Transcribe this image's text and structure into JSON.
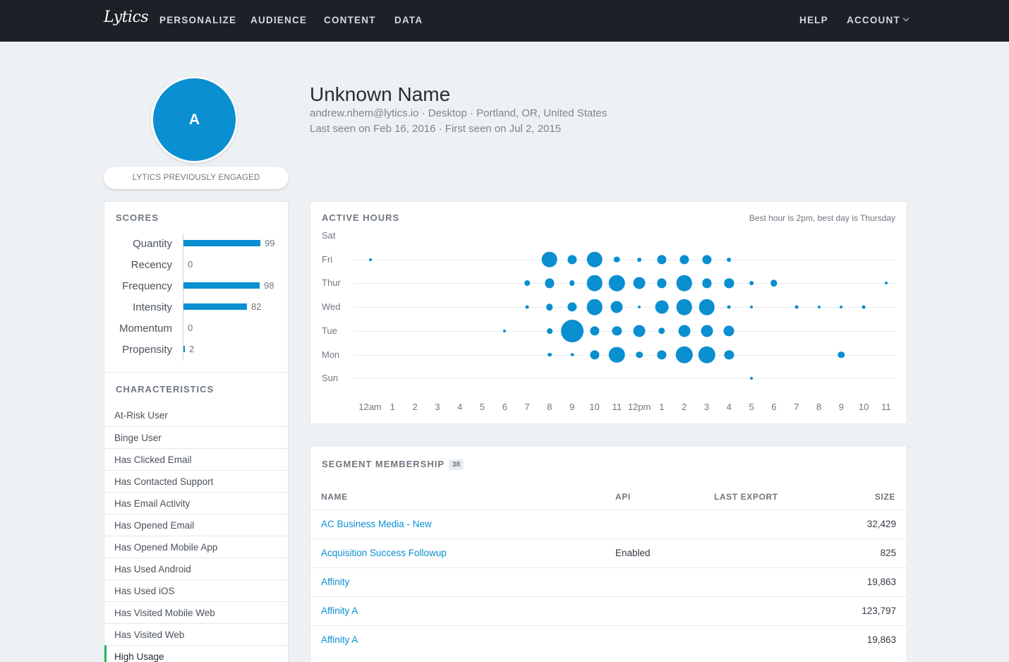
{
  "nav": {
    "logo": "Lytics",
    "items": [
      "PERSONALIZE",
      "AUDIENCE",
      "CONTENT",
      "DATA"
    ],
    "help": "HELP",
    "account": "ACCOUNT"
  },
  "profile": {
    "avatar_initial": "A",
    "engagement": "LYTICS PREVIOUSLY ENGAGED",
    "name": "Unknown Name",
    "details": "andrew.nhem@lytics.io · Desktop · Portland, OR, United States",
    "seen": "Last seen on Feb 16, 2016 · First seen on Jul 2, 2015"
  },
  "scores": {
    "title": "SCORES",
    "max": 100,
    "items": [
      {
        "label": "Quantity",
        "value": 99
      },
      {
        "label": "Recency",
        "value": 0
      },
      {
        "label": "Frequency",
        "value": 98
      },
      {
        "label": "Intensity",
        "value": 82
      },
      {
        "label": "Momentum",
        "value": 0
      },
      {
        "label": "Propensity",
        "value": 2
      }
    ]
  },
  "characteristics": {
    "title": "CHARACTERISTICS",
    "items": [
      "At-Risk User",
      "Binge User",
      "Has Clicked Email",
      "Has Contacted Support",
      "Has Email Activity",
      "Has Opened Email",
      "Has Opened Mobile App",
      "Has Used Android",
      "Has Used iOS",
      "Has Visited Mobile Web",
      "Has Visited Web",
      "High Usage"
    ],
    "active_index": 11
  },
  "active_hours": {
    "title": "ACTIVE HOURS",
    "note": "Best hour is 2pm, best day is Thursday",
    "days": [
      "Sat",
      "Fri",
      "Thur",
      "Wed",
      "Tue",
      "Mon",
      "Sun"
    ],
    "hours": [
      "12am",
      "1",
      "2",
      "3",
      "4",
      "5",
      "6",
      "7",
      "8",
      "9",
      "10",
      "11",
      "12pm",
      "1",
      "2",
      "3",
      "4",
      "5",
      "6",
      "7",
      "8",
      "9",
      "10",
      "11"
    ]
  },
  "chart_data": {
    "type": "scatter",
    "title": "ACTIVE HOURS",
    "x_categories": [
      "12am",
      "1",
      "2",
      "3",
      "4",
      "5",
      "6",
      "7",
      "8",
      "9",
      "10",
      "11",
      "12pm",
      "1",
      "2",
      "3",
      "4",
      "5",
      "6",
      "7",
      "8",
      "9",
      "10",
      "11"
    ],
    "y_categories": [
      "Sat",
      "Fri",
      "Thur",
      "Wed",
      "Tue",
      "Mon",
      "Sun"
    ],
    "value_note": "relative activity level 0-4 shown by dot size",
    "points": [
      {
        "day": "Fri",
        "hour": 0,
        "level": 1
      },
      {
        "day": "Fri",
        "hour": 8,
        "level": 3
      },
      {
        "day": "Fri",
        "hour": 9,
        "level": 2
      },
      {
        "day": "Fri",
        "hour": 10,
        "level": 3
      },
      {
        "day": "Fri",
        "hour": 11,
        "level": 1.5
      },
      {
        "day": "Fri",
        "hour": 12,
        "level": 1.2
      },
      {
        "day": "Fri",
        "hour": 13,
        "level": 2
      },
      {
        "day": "Fri",
        "hour": 14,
        "level": 2
      },
      {
        "day": "Fri",
        "hour": 15,
        "level": 2
      },
      {
        "day": "Fri",
        "hour": 16,
        "level": 1.2
      },
      {
        "day": "Thur",
        "hour": 7,
        "level": 1.4
      },
      {
        "day": "Thur",
        "hour": 8,
        "level": 2
      },
      {
        "day": "Thur",
        "hour": 9,
        "level": 1.4
      },
      {
        "day": "Thur",
        "hour": 10,
        "level": 3
      },
      {
        "day": "Thur",
        "hour": 11,
        "level": 3
      },
      {
        "day": "Thur",
        "hour": 12,
        "level": 2.4
      },
      {
        "day": "Thur",
        "hour": 13,
        "level": 2
      },
      {
        "day": "Thur",
        "hour": 14,
        "level": 3
      },
      {
        "day": "Thur",
        "hour": 15,
        "level": 2
      },
      {
        "day": "Thur",
        "hour": 16,
        "level": 2
      },
      {
        "day": "Thur",
        "hour": 17,
        "level": 1.2
      },
      {
        "day": "Thur",
        "hour": 18,
        "level": 1.6
      },
      {
        "day": "Thur",
        "hour": 23,
        "level": 1
      },
      {
        "day": "Wed",
        "hour": 7,
        "level": 1.1
      },
      {
        "day": "Wed",
        "hour": 8,
        "level": 1.6
      },
      {
        "day": "Wed",
        "hour": 9,
        "level": 2
      },
      {
        "day": "Wed",
        "hour": 10,
        "level": 3
      },
      {
        "day": "Wed",
        "hour": 11,
        "level": 2.4
      },
      {
        "day": "Wed",
        "hour": 12,
        "level": 1
      },
      {
        "day": "Wed",
        "hour": 13,
        "level": 2.6
      },
      {
        "day": "Wed",
        "hour": 14,
        "level": 3
      },
      {
        "day": "Wed",
        "hour": 15,
        "level": 3
      },
      {
        "day": "Wed",
        "hour": 16,
        "level": 1.1
      },
      {
        "day": "Wed",
        "hour": 17,
        "level": 1
      },
      {
        "day": "Wed",
        "hour": 19,
        "level": 1.1
      },
      {
        "day": "Wed",
        "hour": 20,
        "level": 1
      },
      {
        "day": "Wed",
        "hour": 21,
        "level": 1
      },
      {
        "day": "Wed",
        "hour": 22,
        "level": 1.1
      },
      {
        "day": "Tue",
        "hour": 6,
        "level": 1
      },
      {
        "day": "Tue",
        "hour": 8,
        "level": 1.4
      },
      {
        "day": "Tue",
        "hour": 9,
        "level": 4
      },
      {
        "day": "Tue",
        "hour": 10,
        "level": 2
      },
      {
        "day": "Tue",
        "hour": 11,
        "level": 2
      },
      {
        "day": "Tue",
        "hour": 12,
        "level": 2.4
      },
      {
        "day": "Tue",
        "hour": 13,
        "level": 1.6
      },
      {
        "day": "Tue",
        "hour": 14,
        "level": 2.4
      },
      {
        "day": "Tue",
        "hour": 15,
        "level": 2.4
      },
      {
        "day": "Tue",
        "hour": 16,
        "level": 2.2
      },
      {
        "day": "Mon",
        "hour": 8,
        "level": 1.2
      },
      {
        "day": "Mon",
        "hour": 9,
        "level": 1.1
      },
      {
        "day": "Mon",
        "hour": 10,
        "level": 2
      },
      {
        "day": "Mon",
        "hour": 11,
        "level": 3
      },
      {
        "day": "Mon",
        "hour": 12,
        "level": 1.6
      },
      {
        "day": "Mon",
        "hour": 13,
        "level": 2
      },
      {
        "day": "Mon",
        "hour": 14,
        "level": 3.2
      },
      {
        "day": "Mon",
        "hour": 15,
        "level": 3.2
      },
      {
        "day": "Mon",
        "hour": 16,
        "level": 2
      },
      {
        "day": "Mon",
        "hour": 21,
        "level": 1.6
      },
      {
        "day": "Sun",
        "hour": 17,
        "level": 1
      }
    ]
  },
  "segments": {
    "title": "SEGMENT MEMBERSHIP",
    "count": "38",
    "columns": {
      "name": "NAME",
      "api": "API",
      "last_export": "LAST EXPORT",
      "size": "SIZE"
    },
    "rows": [
      {
        "name": "AC Business Media - New",
        "api": "",
        "last_export": "",
        "size": "32,429"
      },
      {
        "name": "Acquisition Success Followup",
        "api": "Enabled",
        "last_export": "",
        "size": "825"
      },
      {
        "name": "Affinity",
        "api": "",
        "last_export": "",
        "size": "19,863"
      },
      {
        "name": "Affinity A",
        "api": "",
        "last_export": "",
        "size": "123,797"
      },
      {
        "name": "Affinity A",
        "api": "",
        "last_export": "",
        "size": "19,863"
      }
    ]
  }
}
